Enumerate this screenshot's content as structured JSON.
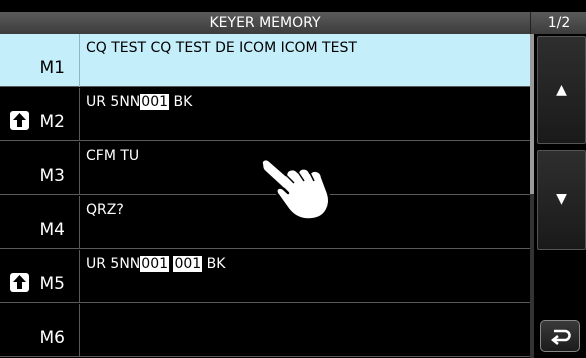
{
  "header": {
    "title": "KEYER MEMORY",
    "page": "1/2"
  },
  "memories": [
    {
      "label": "M1",
      "shift": false,
      "selected": true,
      "parts": [
        "CQ TEST CQ TEST DE ICOM ICOM TEST"
      ]
    },
    {
      "label": "M2",
      "shift": true,
      "selected": false,
      "parts": [
        "UR 5NN",
        "001",
        " BK"
      ]
    },
    {
      "label": "M3",
      "shift": false,
      "selected": false,
      "parts": [
        "CFM TU"
      ]
    },
    {
      "label": "M4",
      "shift": false,
      "selected": false,
      "parts": [
        "QRZ?"
      ]
    },
    {
      "label": "M5",
      "shift": true,
      "selected": false,
      "parts": [
        "UR 5NN",
        "001",
        " ",
        "001",
        " BK"
      ]
    },
    {
      "label": "M6",
      "shift": false,
      "selected": false,
      "parts": [
        ""
      ]
    }
  ],
  "buttons": {
    "scroll_up_icon": "▲",
    "scroll_down_icon": "▼",
    "return_icon": "return-arrow-icon"
  },
  "colors": {
    "selected_row": "#c4eefa",
    "background": "#000000",
    "serial_highlight": "#ffffff"
  }
}
